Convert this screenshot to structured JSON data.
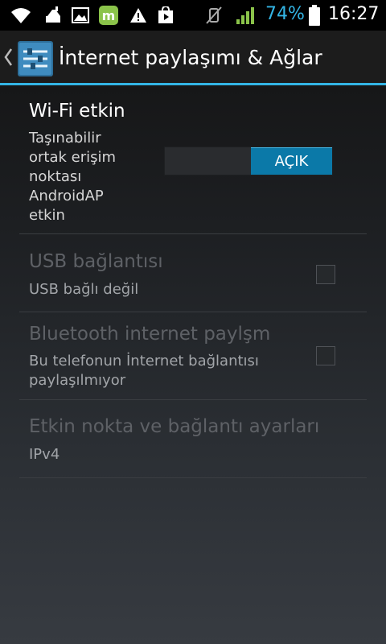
{
  "status_bar": {
    "icons": [
      "wifi-icon",
      "cleaner-icon",
      "gallery-icon",
      "market-icon",
      "warning-icon",
      "play-store-icon",
      "mute-icon",
      "signal-icon",
      "battery-icon"
    ],
    "battery_percent": "74%",
    "time": "16:27",
    "accent_color": "#33b5e5"
  },
  "action_bar": {
    "title": "İnternet paylaşımı & Ağlar",
    "icon": "settings-sliders-icon",
    "accent_color": "#33b5e5"
  },
  "settings": {
    "wifi_hotspot": {
      "title": "Wi-Fi etkin",
      "summary": "Taşınabilir ortak erişim noktası AndroidAP etkin",
      "toggle_label": "AÇIK",
      "toggle_on": true
    },
    "usb_tethering": {
      "title": "USB bağlantısı",
      "summary": "USB bağlı değil",
      "checked": false,
      "enabled": false
    },
    "bluetooth_tethering": {
      "title": "Bluetooth internet paylşm",
      "summary": "Bu telefonun İnternet bağlantısı paylaşılmıyor",
      "checked": false,
      "enabled": false
    },
    "hotspot_settings": {
      "title": "Etkin nokta ve bağlantı ayarları",
      "summary": "IPv4",
      "enabled": false
    }
  }
}
